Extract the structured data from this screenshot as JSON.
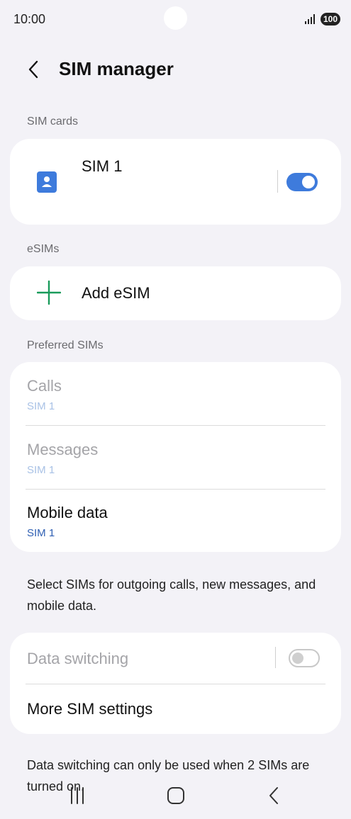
{
  "status": {
    "time": "10:00",
    "battery": "100"
  },
  "header": {
    "title": "SIM manager"
  },
  "sim_cards": {
    "label": "SIM cards",
    "items": [
      {
        "name": "SIM 1",
        "enabled": true
      }
    ]
  },
  "esims": {
    "label": "eSIMs",
    "add_label": "Add eSIM"
  },
  "preferred": {
    "label": "Preferred SIMs",
    "rows": [
      {
        "title": "Calls",
        "value": "SIM 1",
        "enabled": false
      },
      {
        "title": "Messages",
        "value": "SIM 1",
        "enabled": false
      },
      {
        "title": "Mobile data",
        "value": "SIM 1",
        "enabled": true
      }
    ],
    "description": "Select SIMs for outgoing calls, new messages, and mobile data."
  },
  "settings": {
    "data_switching": {
      "label": "Data switching",
      "enabled": false
    },
    "more_label": "More SIM settings",
    "footnote": "Data switching can only be used when 2 SIMs are turned on."
  },
  "colors": {
    "accent": "#3e7bdc",
    "plus": "#1a9b5b",
    "sim_icon": "#3e7bdc"
  },
  "icons": [
    "back-icon",
    "sim-card-icon",
    "plus-icon",
    "recents-icon",
    "home-icon",
    "nav-back-icon"
  ]
}
